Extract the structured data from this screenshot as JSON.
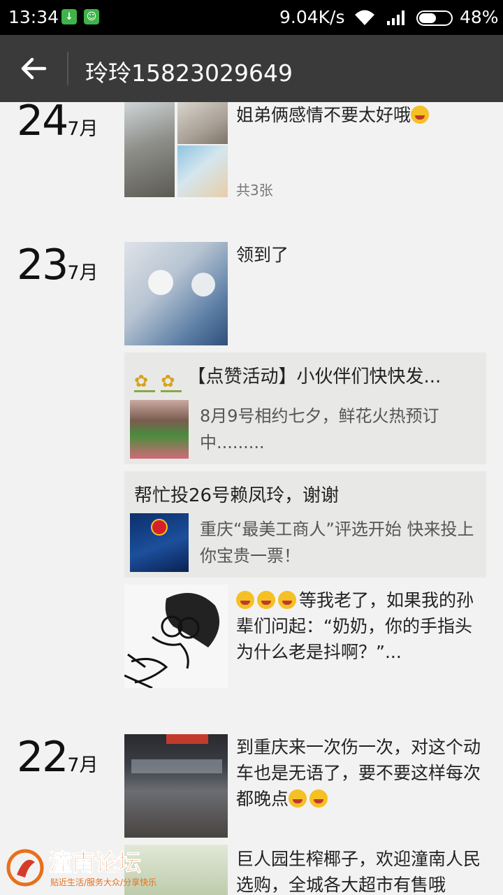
{
  "status_bar": {
    "time": "13:34",
    "speed": "9.04K/s",
    "battery": "48%",
    "icons": [
      "download-icon",
      "android-icon",
      "wifi-icon",
      "signal-icon",
      "battery-icon"
    ]
  },
  "header": {
    "title": "玲玲15823029649",
    "back_icon": "arrow-left-icon"
  },
  "days": [
    {
      "day": "24",
      "month": "7月",
      "posts": [
        {
          "text": "姐弟俩感情不要太好哦",
          "count": "共3张"
        }
      ]
    },
    {
      "day": "23",
      "month": "7月",
      "posts": [
        {
          "text": "领到了"
        },
        {
          "share_title": "【点赞活动】小伙伴们快快发...",
          "share_desc": "8月9号相约七夕，鲜花火热预订中........."
        },
        {
          "share_title": "帮忙投26号赖凤玲，谢谢",
          "share_desc": "重庆“最美工商人”评选开始 快来投上你宝贵一票！"
        },
        {
          "text": "等我老了，如果我的孙辈们问起：“奶奶，你的手指头为什么老是抖啊？”..."
        }
      ]
    },
    {
      "day": "22",
      "month": "7月",
      "posts": [
        {
          "text": "到重庆来一次伤一次，对这个动车也是无语了，要不要这样每次都晚点"
        },
        {
          "text": "巨人园生榨椰子，欢迎潼南人民选购，全城各大超市有售哦"
        }
      ]
    }
  ],
  "watermark": {
    "title": "潼南论坛",
    "subtitle": "贴近生活/服务大众/分享快乐"
  },
  "colors": {
    "status_bar": "#000000",
    "title_bar": "#3a3a3a",
    "background": "#f2f2f2",
    "share_card": "#e8e9e6",
    "watermark": "#e8701a"
  }
}
